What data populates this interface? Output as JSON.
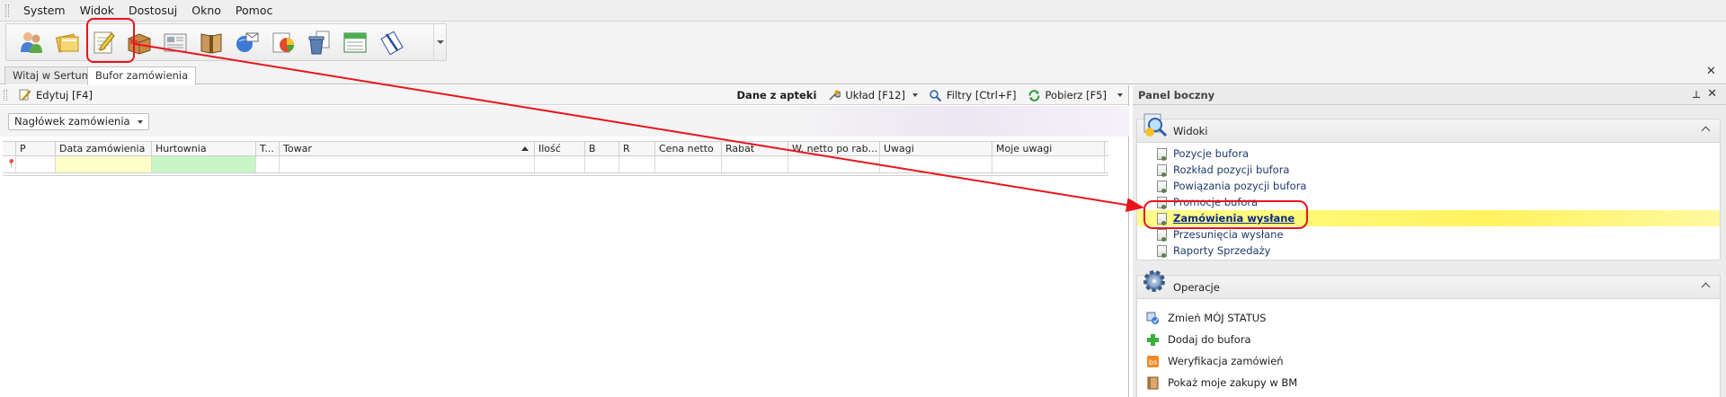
{
  "menu": {
    "items": [
      "System",
      "Widok",
      "Dostosuj",
      "Okno",
      "Pomoc"
    ]
  },
  "toolbar": {
    "buttons": [
      {
        "icon": "users-icon"
      },
      {
        "icon": "folders-icon"
      },
      {
        "icon": "notepad-pencil-icon"
      },
      {
        "icon": "box-icon"
      },
      {
        "icon": "newspaper-icon"
      },
      {
        "icon": "book-icon"
      },
      {
        "icon": "mail-globe-icon"
      },
      {
        "icon": "chart-report-icon"
      },
      {
        "icon": "trash-document-icon"
      },
      {
        "icon": "calendar-icon"
      },
      {
        "icon": "clip-document-icon"
      }
    ]
  },
  "tabs": [
    {
      "label": "Witaj w Sertum",
      "active": false
    },
    {
      "label": "Bufor zamówienia",
      "active": true
    }
  ],
  "main_toolbar": {
    "edit_label": "Edytuj [F4]",
    "pharmacy_data_label": "Dane z apteki",
    "layout_label": "Układ [F12]",
    "filters_label": "Filtry [Ctrl+F]",
    "fetch_label": "Pobierz [F5]"
  },
  "group_by": {
    "label": "Nagłówek zamówienia"
  },
  "grid": {
    "columns": [
      "P",
      "Data zamówienia",
      "Hurtownia",
      "T...",
      "Towar",
      "Ilość",
      "B",
      "R",
      "Cena netto",
      "Rabat",
      "W. netto po rab...",
      "Uwagi",
      "Moje uwagi"
    ],
    "sorted_column": "Towar",
    "filter_row_icon": "filter-pin-icon"
  },
  "side_panel": {
    "title": "Panel boczny",
    "views": {
      "title": "Widoki",
      "items": [
        "Pozycje bufora",
        "Rozkład pozycji bufora",
        "Powiązania pozycji bufora",
        "Promocje bufora",
        "Zamówienia wysłane",
        "Przesunięcia wysłane",
        "Raporty Sprzedaży"
      ],
      "selected": "Zamówienia wysłane"
    },
    "operations": {
      "title": "Operacje",
      "items": [
        {
          "label": "Zmień MÓJ STATUS",
          "icon": "status-change-icon"
        },
        {
          "label": "Dodaj do bufora",
          "icon": "green-plus-icon"
        },
        {
          "label": "Weryfikacja zamówień",
          "icon": "verify-orders-icon"
        },
        {
          "label": "Pokaż moje zakupy w BM",
          "icon": "purchases-book-icon"
        }
      ]
    }
  },
  "colors": {
    "highlight_red": "#e8141b",
    "selected_yellow": "#fff35e",
    "filter_yellow": "#fefec8",
    "filter_green": "#c8f5c8"
  }
}
